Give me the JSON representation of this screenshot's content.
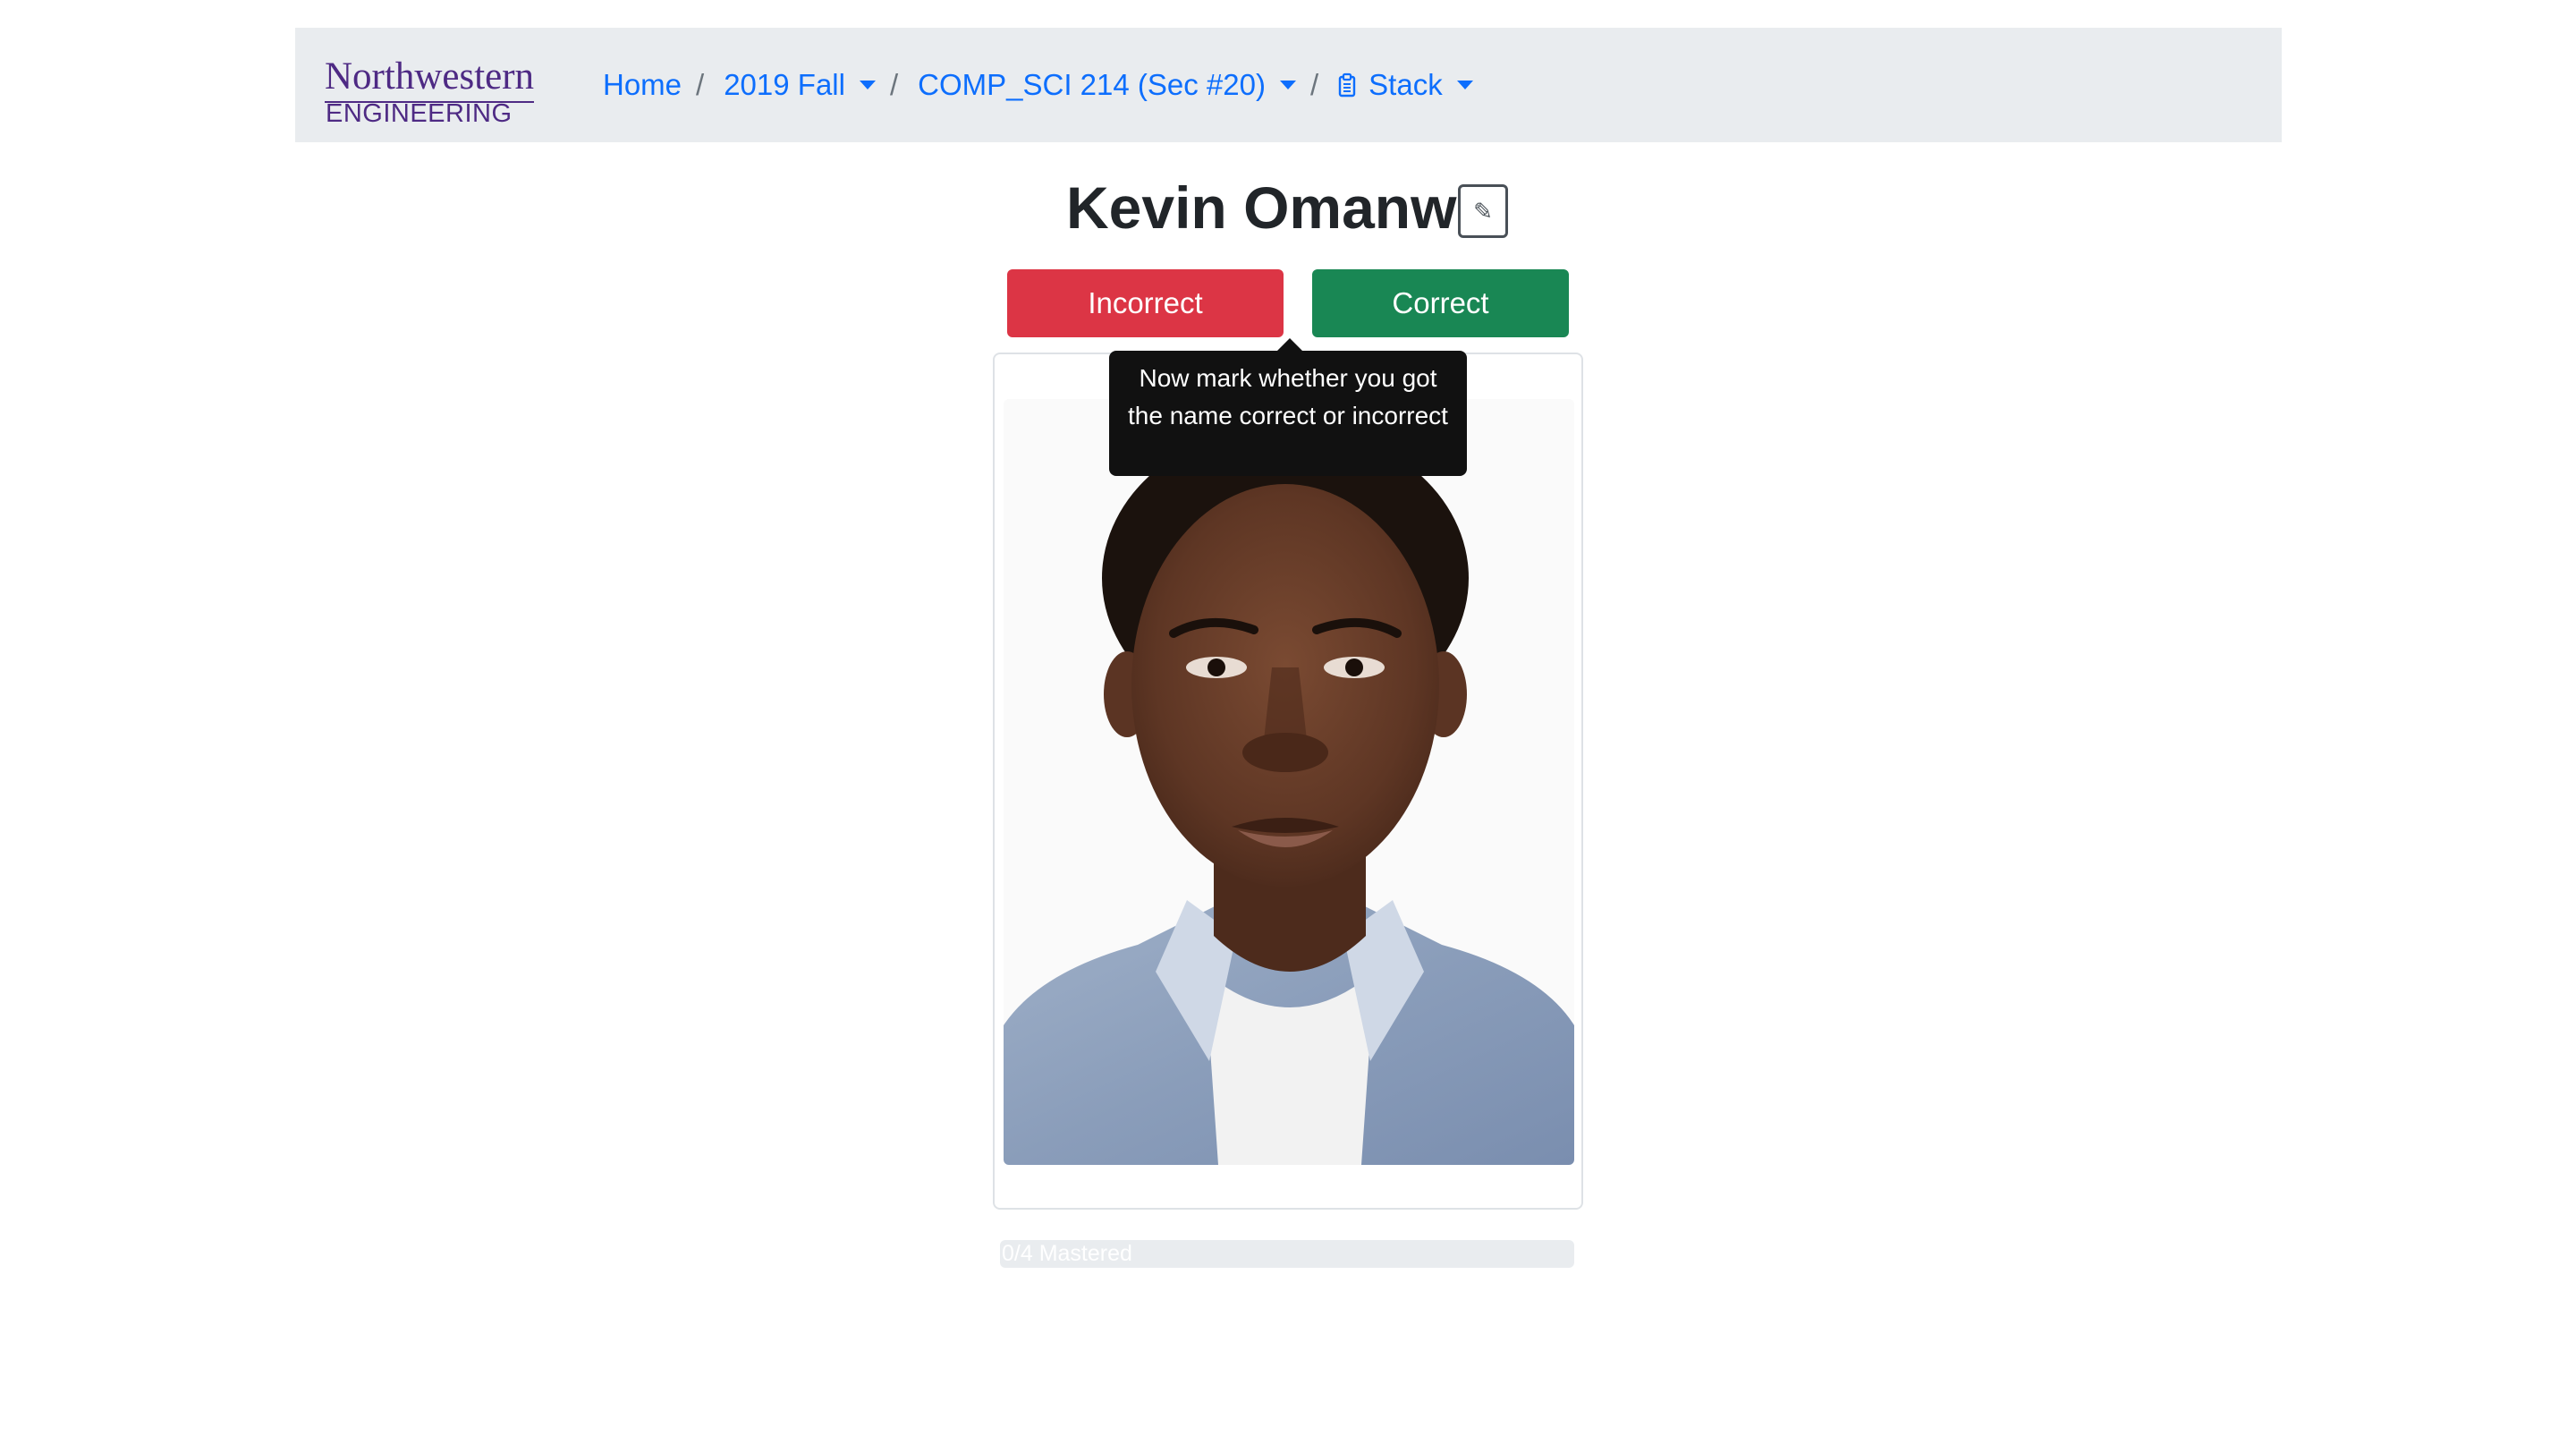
{
  "navbar": {
    "logo": {
      "top": "Northwestern",
      "bottom": "ENGINEERING"
    },
    "breadcrumb": {
      "home": "Home",
      "term": "2019 Fall",
      "course": "COMP_SCI 214 (Sec #20)",
      "mode": "Stack"
    }
  },
  "student": {
    "name": "Kevin Omanwa",
    "edit_icon": "pencil-icon",
    "edit_glyph": "✎"
  },
  "actions": {
    "incorrect_label": "Incorrect",
    "correct_label": "Correct"
  },
  "tooltip": {
    "text": "Now mark whether you got the name correct or incorrect"
  },
  "progress": {
    "mastered": 0,
    "total": 4,
    "fraction": 0,
    "label": "0/4 Mastered"
  },
  "colors": {
    "navbar_bg": "#e9ecef",
    "link": "#0d6efd",
    "incorrect": "#dc3545",
    "correct": "#198754",
    "brand_purple": "#4e2a84",
    "tooltip_bg": "#111111"
  },
  "icons": {
    "stack": "clipboard-stack-icon",
    "dropdown": "caret-down-icon"
  }
}
